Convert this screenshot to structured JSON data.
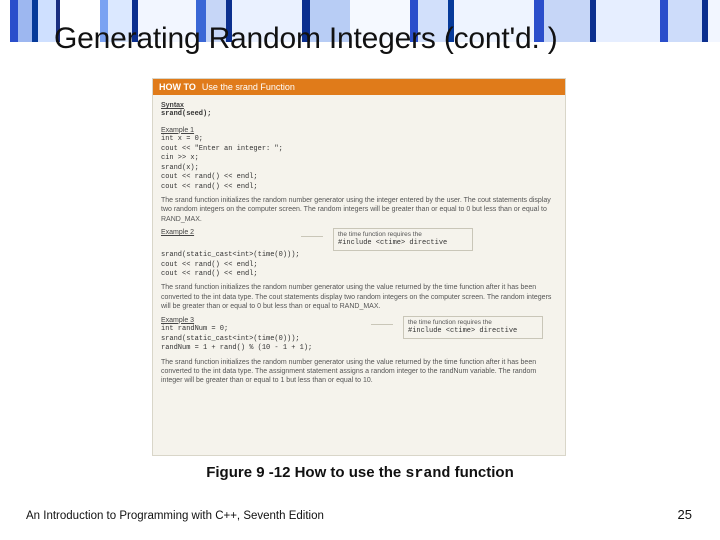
{
  "slide": {
    "title": "Generating Random Integers (cont'd. )"
  },
  "howto": {
    "pill": "HOW TO",
    "desc": "Use the srand Function",
    "syntax_label": "Syntax",
    "syntax_code": "srand(seed);"
  },
  "ex1": {
    "label": "Example 1",
    "l1": "int x = 0;",
    "l2": "cout << \"Enter an integer: \";",
    "l3": "cin >> x;",
    "l4": "srand(x);",
    "l5": "cout << rand() << endl;",
    "l6": "cout << rand() << endl;",
    "para": "The srand function initializes the random number generator using the integer entered by the user. The cout statements display two random integers on the computer screen. The random integers will be greater than or equal to 0 but less than or equal to RAND_MAX."
  },
  "note2": {
    "l1": "the time function requires the",
    "l2": "#include <ctime> directive"
  },
  "ex2": {
    "label": "Example 2",
    "l1": "srand(static_cast<int>(time(0)));",
    "l2": "cout << rand() << endl;",
    "l3": "cout << rand() << endl;",
    "para": "The srand function initializes the random number generator using the value returned by the time function after it has been converted to the int data type. The cout statements display two random integers on the computer screen. The random integers will be greater than or equal to 0 but less than or equal to RAND_MAX."
  },
  "note3": {
    "l1": "the time function requires the",
    "l2": "#include <ctime> directive"
  },
  "ex3": {
    "label": "Example 3",
    "l1": "int randNum = 0;",
    "l2": "srand(static_cast<int>(time(0)));",
    "l3": "randNum = 1 + rand() % (10 - 1 + 1);",
    "para": "The srand function initializes the random number generator using the value returned by the time function after it has been converted to the int data type. The assignment statement assigns a random integer to the randNum variable. The random integer will be greater than or equal to 1 but less than or equal to 10."
  },
  "caption": {
    "pre": "Figure 9 -12 How to use the ",
    "mono": "srand",
    "post": " function"
  },
  "footer": {
    "left": "An Introduction to Programming with C++, Seventh Edition",
    "right": "25"
  }
}
